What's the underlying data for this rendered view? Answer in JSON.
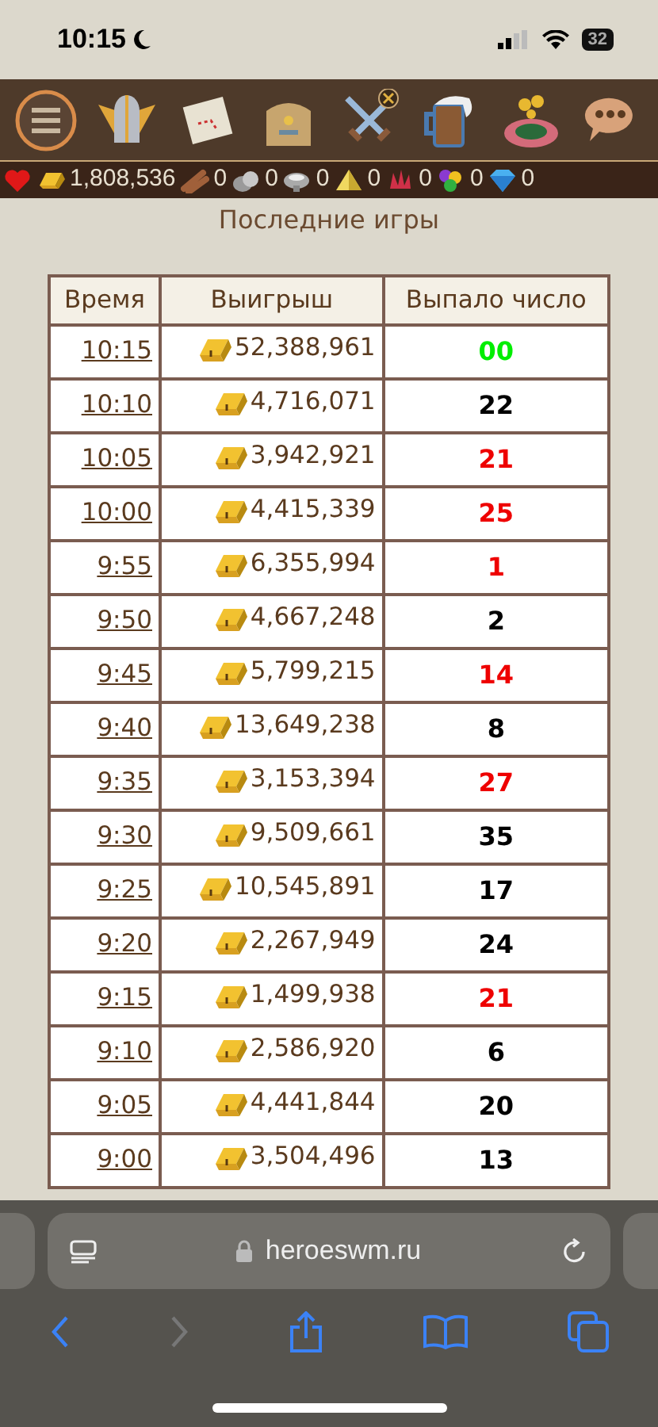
{
  "status_bar": {
    "time": "10:15",
    "battery": "32"
  },
  "resources": [
    {
      "kind": "gold",
      "amount": "1,808,536"
    },
    {
      "kind": "wood",
      "amount": "0"
    },
    {
      "kind": "ore",
      "amount": "0"
    },
    {
      "kind": "mercury",
      "amount": "0"
    },
    {
      "kind": "sulfur",
      "amount": "0"
    },
    {
      "kind": "crystal",
      "amount": "0"
    },
    {
      "kind": "gems",
      "amount": "0"
    },
    {
      "kind": "diamond",
      "amount": "0"
    }
  ],
  "title": "Последние игры",
  "table": {
    "columns": [
      "Время",
      "Выигрыш",
      "Выпало число"
    ],
    "rows": [
      {
        "time": "10:15",
        "win": "52,388,961",
        "number": "00",
        "color": "#00ee00"
      },
      {
        "time": "10:10",
        "win": "4,716,071",
        "number": "22",
        "color": "#000000"
      },
      {
        "time": "10:05",
        "win": "3,942,921",
        "number": "21",
        "color": "#ee0000"
      },
      {
        "time": "10:00",
        "win": "4,415,339",
        "number": "25",
        "color": "#ee0000"
      },
      {
        "time": "9:55",
        "win": "6,355,994",
        "number": "1",
        "color": "#ee0000"
      },
      {
        "time": "9:50",
        "win": "4,667,248",
        "number": "2",
        "color": "#000000"
      },
      {
        "time": "9:45",
        "win": "5,799,215",
        "number": "14",
        "color": "#ee0000"
      },
      {
        "time": "9:40",
        "win": "13,649,238",
        "number": "8",
        "color": "#000000"
      },
      {
        "time": "9:35",
        "win": "3,153,394",
        "number": "27",
        "color": "#ee0000"
      },
      {
        "time": "9:30",
        "win": "9,509,661",
        "number": "35",
        "color": "#000000"
      },
      {
        "time": "9:25",
        "win": "10,545,891",
        "number": "17",
        "color": "#000000"
      },
      {
        "time": "9:20",
        "win": "2,267,949",
        "number": "24",
        "color": "#000000"
      },
      {
        "time": "9:15",
        "win": "1,499,938",
        "number": "21",
        "color": "#ee0000"
      },
      {
        "time": "9:10",
        "win": "2,586,920",
        "number": "6",
        "color": "#000000"
      },
      {
        "time": "9:05",
        "win": "4,441,844",
        "number": "20",
        "color": "#000000"
      },
      {
        "time": "9:00",
        "win": "3,504,496",
        "number": "13",
        "color": "#000000"
      }
    ]
  },
  "browser": {
    "url": "heroeswm.ru"
  }
}
